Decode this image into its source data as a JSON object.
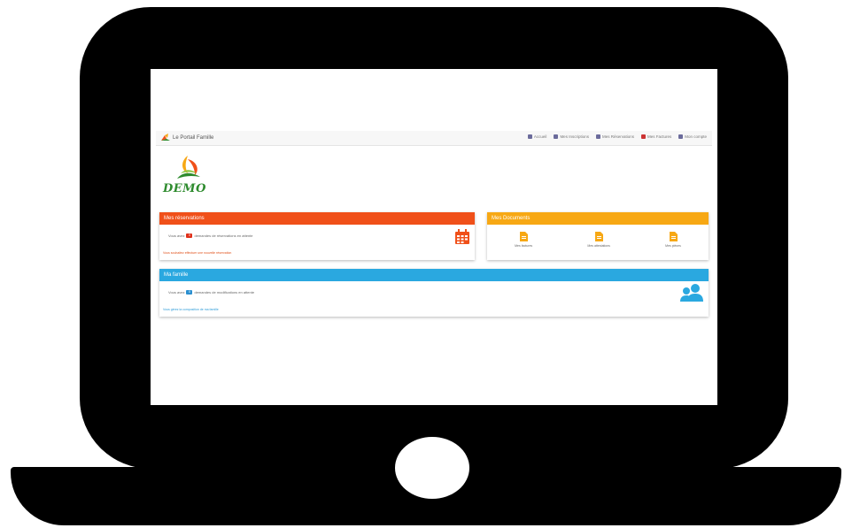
{
  "app": {
    "brand": "Le Portail Famille",
    "logo_text": "DEMO"
  },
  "nav": {
    "items": [
      {
        "label": "Accueil",
        "icon": "home-icon"
      },
      {
        "label": "Mes Inscriptions",
        "icon": "list-icon"
      },
      {
        "label": "Mes Réservations",
        "icon": "calendar-icon"
      },
      {
        "label": "Mes Factures",
        "icon": "file-icon"
      },
      {
        "label": "Mon compte",
        "icon": "user-icon"
      }
    ]
  },
  "reservations": {
    "title": "Mes réservations",
    "line_prefix": "Vous avez",
    "count": "0",
    "line_suffix": "demandes de réservations en attente",
    "link": "Vous souhaitez effectuer une nouvelle réservation"
  },
  "documents": {
    "title": "Mes Documents",
    "items": [
      "Mes factures",
      "Mes attestations",
      "Mes pièces"
    ]
  },
  "famille": {
    "title": "Ma famille",
    "line_prefix": "Vous avez",
    "count": "0",
    "line_suffix": "demandes de modifications en attente",
    "link": "Vous gérez la composition de ma famille"
  },
  "colors": {
    "reservations": "#f05019",
    "documents": "#f7a814",
    "famille": "#2aa8e0",
    "logo_green": "#2e8b2e"
  }
}
